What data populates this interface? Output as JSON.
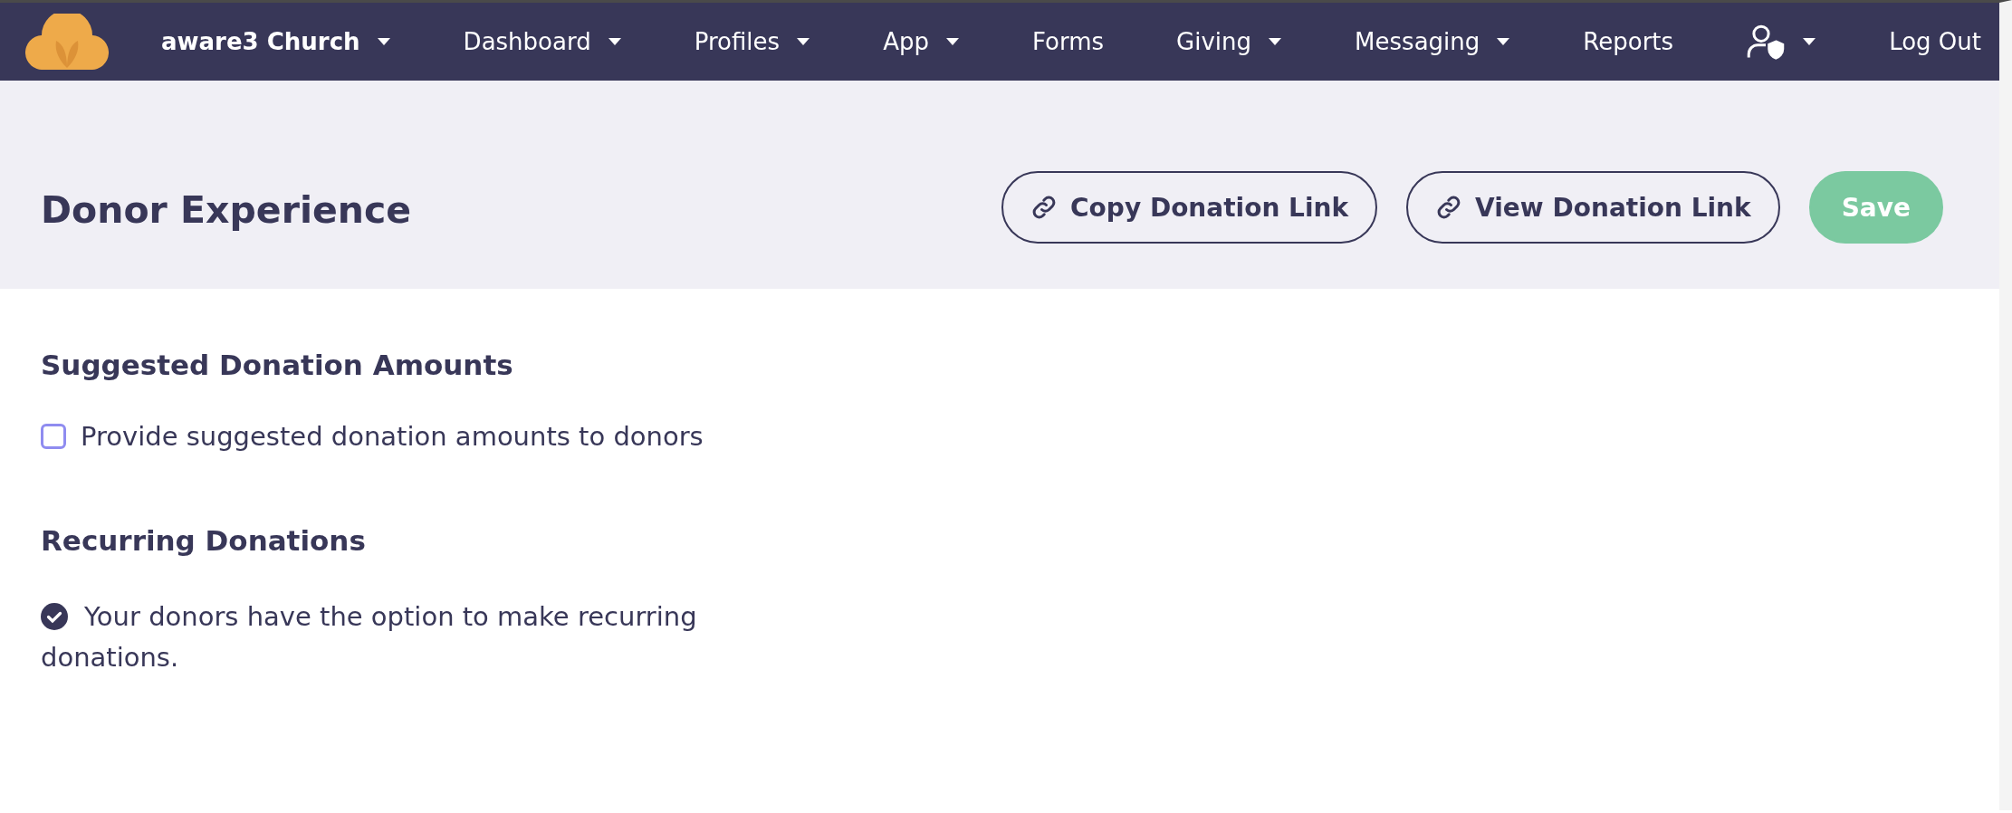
{
  "nav": {
    "brand": {
      "label": "aware3 Church",
      "has_menu": true
    },
    "items": [
      {
        "kind": "text",
        "label": "Dashboard",
        "has_menu": true
      },
      {
        "kind": "text",
        "label": "Profiles",
        "has_menu": true
      },
      {
        "kind": "text",
        "label": "App",
        "has_menu": true
      },
      {
        "kind": "text",
        "label": "Forms",
        "has_menu": false
      },
      {
        "kind": "text",
        "label": "Giving",
        "has_menu": true
      },
      {
        "kind": "text",
        "label": "Messaging",
        "has_menu": true
      },
      {
        "kind": "text",
        "label": "Reports",
        "has_menu": false
      },
      {
        "kind": "user",
        "has_menu": true
      },
      {
        "kind": "text",
        "label": "Log Out",
        "has_menu": false
      }
    ]
  },
  "header": {
    "title": "Donor Experience",
    "buttons": [
      {
        "kind": "link",
        "label": "Copy Donation Link"
      },
      {
        "kind": "link",
        "label": "View Donation Link"
      },
      {
        "kind": "primary",
        "label": "Save"
      }
    ]
  },
  "sections": [
    {
      "title": "Suggested Donation Amounts",
      "option": {
        "kind": "checkbox",
        "label": "Provide suggested donation amounts to donors",
        "checked": false
      }
    },
    {
      "title": "Recurring Donations",
      "option": {
        "kind": "note",
        "label": "Your donors have the option to make recurring donations."
      }
    }
  ]
}
